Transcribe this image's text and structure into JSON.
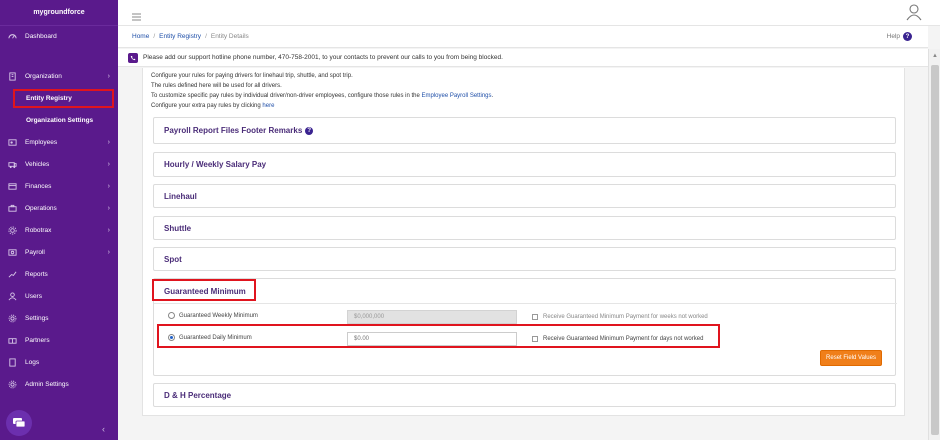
{
  "brand": "mygroundforce",
  "sidebar": {
    "items": [
      {
        "label": "Dashboard",
        "icon": "dashboard-icon",
        "chevron": false
      },
      {
        "label": "Organization",
        "icon": "organization-icon",
        "chevron": true
      },
      {
        "label": "Employees",
        "icon": "employees-icon",
        "chevron": true
      },
      {
        "label": "Vehicles",
        "icon": "vehicles-icon",
        "chevron": true
      },
      {
        "label": "Finances",
        "icon": "finances-icon",
        "chevron": true
      },
      {
        "label": "Operations",
        "icon": "operations-icon",
        "chevron": true
      },
      {
        "label": "Robotrax",
        "icon": "robotrax-icon",
        "chevron": true
      },
      {
        "label": "Payroll",
        "icon": "payroll-icon",
        "chevron": true
      },
      {
        "label": "Reports",
        "icon": "reports-icon",
        "chevron": false
      },
      {
        "label": "Users",
        "icon": "users-icon",
        "chevron": false
      },
      {
        "label": "Settings",
        "icon": "settings-icon",
        "chevron": false
      },
      {
        "label": "Partners",
        "icon": "partners-icon",
        "chevron": false
      },
      {
        "label": "Logs",
        "icon": "logs-icon",
        "chevron": false
      },
      {
        "label": "Admin Settings",
        "icon": "admin-settings-icon",
        "chevron": false
      }
    ],
    "sub_items": [
      {
        "label": "Entity Registry",
        "active": true
      },
      {
        "label": "Organization Settings",
        "active": false
      }
    ],
    "chevron_glyph": "›",
    "collapse_glyph": "‹"
  },
  "breadcrumb": {
    "home": "Home",
    "registry": "Entity Registry",
    "current": "Entity Details",
    "separator": "/"
  },
  "help_label": "Help",
  "help_glyph": "?",
  "notice": "Please add our support hotline phone number, 470-758-2001, to your contacts to prevent our calls to you from being blocked.",
  "intro": {
    "line1": "Configure your rules for paying drivers for linehaul trip, shuttle, and spot trip.",
    "line2": "The rules defined here will be used for all drivers.",
    "line3_prefix": "To customize specific pay rules by individual driver/non-driver employees, configure those rules in the ",
    "line3_link": "Employee Payroll Settings",
    "line3_suffix": ".",
    "line4_prefix": "Configure your extra pay rules by clicking ",
    "line4_link": "here"
  },
  "sections": {
    "footer_remarks": "Payroll Report Files Footer Remarks",
    "hourly": "Hourly / Weekly Salary Pay",
    "linehaul": "Linehaul",
    "shuttle": "Shuttle",
    "spot": "Spot",
    "guaranteed": "Guaranteed Minimum",
    "dh": "D & H Percentage"
  },
  "guaranteed": {
    "weekly_label": "Guaranteed Weekly Minimum",
    "weekly_value": "$0,000,000",
    "weekly_checkbox": "Receive Guaranteed Minimum Payment for weeks not worked",
    "daily_label": "Guaranteed Daily Minimum",
    "daily_value": "$0.00",
    "daily_checkbox": "Receive Guaranteed Minimum Payment for days not worked",
    "selected": "daily",
    "reset_label": "Reset Field Values"
  },
  "colors": {
    "sidebar": "#5a1a8c",
    "accent": "#f07f1a",
    "highlight": "#e0141e",
    "link": "#1f4fa8"
  }
}
